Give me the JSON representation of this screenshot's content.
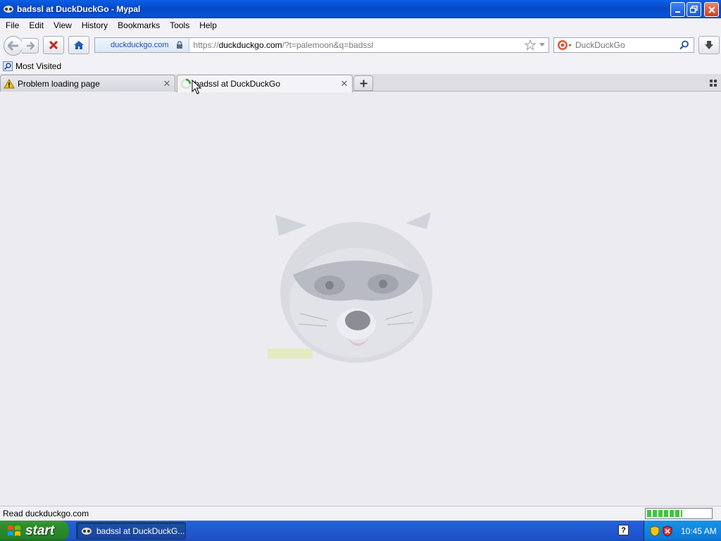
{
  "window": {
    "title": "badssl at DuckDuckGo - Mypal"
  },
  "menubar": {
    "items": [
      "File",
      "Edit",
      "View",
      "History",
      "Bookmarks",
      "Tools",
      "Help"
    ]
  },
  "navbar": {
    "identity_domain": "duckduckgo.com",
    "url_prefix": "https://",
    "url_host": "duckduckgo.com",
    "url_path": "/?t=palemoon&q=badssl",
    "search_placeholder": "DuckDuckGo"
  },
  "bookmarks": {
    "most_visited": "Most Visited"
  },
  "tabs": [
    {
      "label": "Problem loading page",
      "state": "warning"
    },
    {
      "label": "badssl at DuckDuckGo",
      "state": "loading"
    }
  ],
  "statusbar": {
    "text": "Read duckduckgo.com",
    "progress": 0.55
  },
  "taskbar": {
    "start_label": "start",
    "task_label": "badssl at DuckDuckG...",
    "clock": "10:45 AM"
  },
  "colors": {
    "accent": "#0a5ee6",
    "progress": "#3ec63e"
  }
}
